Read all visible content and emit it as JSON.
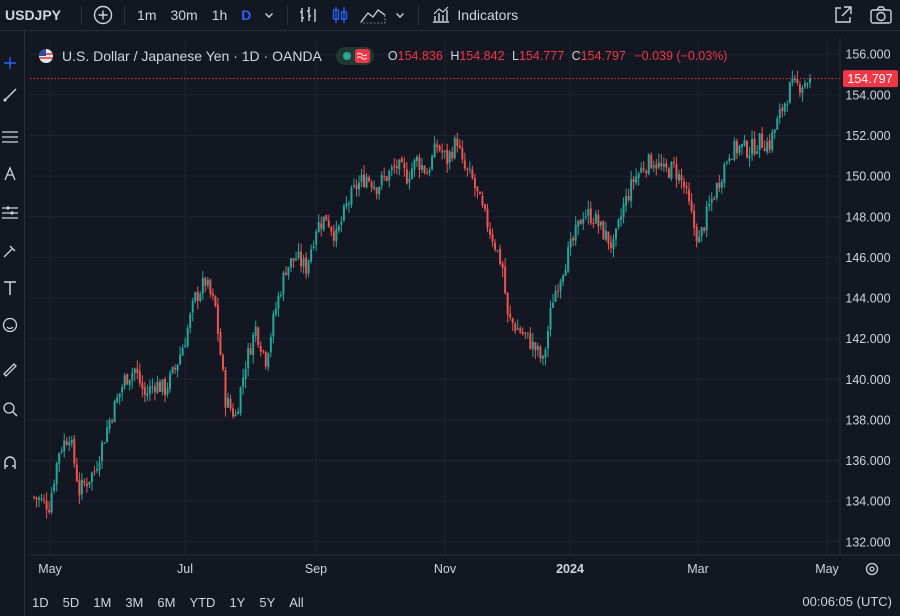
{
  "toolbar": {
    "symbol": "USDJPY",
    "intervals": [
      "1m",
      "30m",
      "1h",
      "D"
    ],
    "active_interval": "D",
    "indicators_label": "Indicators"
  },
  "legend": {
    "title": "U.S. Dollar / Japanese Yen · 1D · OANDA",
    "open_key": "O",
    "open": "154.836",
    "high_key": "H",
    "high": "154.842",
    "low_key": "L",
    "low": "154.777",
    "close_key": "C",
    "close": "154.797",
    "change": "−0.039 (−0.03%)"
  },
  "price_scale": {
    "ticks": [
      "156.000",
      "154.000",
      "152.000",
      "150.000",
      "148.000",
      "146.000",
      "144.000",
      "142.000",
      "140.000",
      "138.000",
      "136.000",
      "134.000",
      "132.000"
    ],
    "current_price": "154.797"
  },
  "time_scale": {
    "labels": [
      "May",
      "Jul",
      "Sep",
      "Nov",
      "2024",
      "Mar",
      "May"
    ]
  },
  "timeframes": [
    "1D",
    "5D",
    "1M",
    "3M",
    "6M",
    "YTD",
    "1Y",
    "5Y",
    "All"
  ],
  "clock": "00:06:05 (UTC)",
  "colors": {
    "up": "#26a69a",
    "down": "#ef5350",
    "background": "#131722",
    "accent": "#2962ff"
  },
  "chart_data": {
    "type": "candlestick",
    "title": "U.S. Dollar / Japanese Yen · 1D · OANDA",
    "ylim": [
      131.4,
      156.7
    ],
    "y_ticks": [
      132,
      134,
      136,
      138,
      140,
      142,
      144,
      146,
      148,
      150,
      152,
      154,
      156
    ],
    "x_tick_labels": [
      "May",
      "Jul",
      "Sep",
      "Nov",
      "2024",
      "Mar",
      "May"
    ],
    "last_price": 154.797,
    "grid": true,
    "approx_close_path": [
      [
        0,
        134.2
      ],
      [
        6,
        133.8
      ],
      [
        10,
        136.5
      ],
      [
        14,
        137.3
      ],
      [
        18,
        134.5
      ],
      [
        24,
        135.5
      ],
      [
        30,
        138.0
      ],
      [
        36,
        140.0
      ],
      [
        40,
        140.5
      ],
      [
        44,
        139.2
      ],
      [
        48,
        139.8
      ],
      [
        52,
        139.5
      ],
      [
        56,
        140.5
      ],
      [
        60,
        142.0
      ],
      [
        64,
        144.0
      ],
      [
        68,
        144.8
      ],
      [
        72,
        143.5
      ],
      [
        76,
        139.0
      ],
      [
        80,
        138.2
      ],
      [
        84,
        140.8
      ],
      [
        88,
        142.5
      ],
      [
        92,
        141.0
      ],
      [
        96,
        143.5
      ],
      [
        100,
        145.5
      ],
      [
        104,
        146.0
      ],
      [
        108,
        145.5
      ],
      [
        112,
        147.5
      ],
      [
        116,
        148.0
      ],
      [
        120,
        147.0
      ],
      [
        124,
        148.5
      ],
      [
        128,
        149.5
      ],
      [
        132,
        150.0
      ],
      [
        136,
        149.5
      ],
      [
        140,
        150.0
      ],
      [
        144,
        150.5
      ],
      [
        148,
        150.0
      ],
      [
        152,
        150.8
      ],
      [
        156,
        150.2
      ],
      [
        160,
        151.5
      ],
      [
        164,
        150.8
      ],
      [
        168,
        151.8
      ],
      [
        170,
        150.5
      ],
      [
        174,
        149.8
      ],
      [
        178,
        148.3
      ],
      [
        182,
        147.0
      ],
      [
        186,
        145.5
      ],
      [
        188,
        143.0
      ],
      [
        192,
        142.5
      ],
      [
        196,
        142.0
      ],
      [
        200,
        141.3
      ],
      [
        202,
        140.8
      ],
      [
        206,
        144.0
      ],
      [
        210,
        145.5
      ],
      [
        214,
        146.8
      ],
      [
        218,
        148.2
      ],
      [
        222,
        148.0
      ],
      [
        226,
        147.2
      ],
      [
        230,
        146.5
      ],
      [
        234,
        148.5
      ],
      [
        238,
        149.8
      ],
      [
        242,
        150.5
      ],
      [
        246,
        150.8
      ],
      [
        250,
        150.2
      ],
      [
        254,
        150.4
      ],
      [
        258,
        149.5
      ],
      [
        262,
        147.5
      ],
      [
        264,
        146.8
      ],
      [
        268,
        148.5
      ],
      [
        272,
        149.8
      ],
      [
        276,
        151.2
      ],
      [
        280,
        151.4
      ],
      [
        284,
        151.3
      ],
      [
        288,
        151.7
      ],
      [
        292,
        151.6
      ],
      [
        296,
        153.0
      ],
      [
        300,
        154.3
      ],
      [
        304,
        154.5
      ],
      [
        308,
        154.8
      ]
    ]
  }
}
